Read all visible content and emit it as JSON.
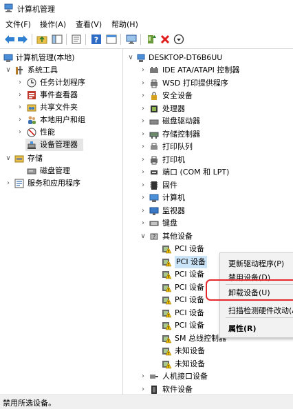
{
  "window": {
    "title": "计算机管理"
  },
  "menu": [
    "文件(F)",
    "操作(A)",
    "查看(V)",
    "帮助(H)"
  ],
  "toolbar_icons": [
    "back-icon",
    "forward-icon",
    "up-icon",
    "show-hide-tree-icon",
    "properties-icon",
    "help-icon",
    "view-icon",
    "monitor-icon",
    "update-driver-icon",
    "uninstall-icon",
    "disable-icon"
  ],
  "left_tree": {
    "root": "计算机管理(本地)",
    "system_tools": "系统工具",
    "task_scheduler": "任务计划程序",
    "event_viewer": "事件查看器",
    "shared_folders": "共享文件夹",
    "local_users": "本地用户和组",
    "performance": "性能",
    "device_manager": "设备管理器",
    "storage": "存储",
    "disk_management": "磁盘管理",
    "services": "服务和应用程序"
  },
  "right_tree": {
    "computer": "DESKTOP-DT6B6UU",
    "categories": [
      "IDE ATA/ATAPI 控制器",
      "WSD 打印提供程序",
      "安全设备",
      "处理器",
      "磁盘驱动器",
      "存储控制器",
      "打印队列",
      "打印机",
      "端口 (COM 和 LPT)",
      "固件",
      "计算机",
      "监视器",
      "键盘"
    ],
    "other_devices": "其他设备",
    "other_children": [
      "PCI 设备",
      "PCI 设备",
      "PCI 设备",
      "PCI 设备",
      "PCI 设备",
      "PCI 设备",
      "PCI 设备",
      "SM 总线控制器",
      "未知设备",
      "未知设备"
    ],
    "after": [
      "人机接口设备",
      "软件设备"
    ]
  },
  "context_menu": {
    "update_driver": "更新驱动程序(P)",
    "disable": "禁用设备(D)",
    "uninstall": "卸载设备(U)",
    "scan": "扫描检测硬件改动(A)",
    "properties": "属性(R)"
  },
  "status": "禁用所选设备。",
  "colors": {
    "highlight_box": "#e4282b",
    "selection": "#e5e5e5",
    "warning": "#f0c000"
  }
}
